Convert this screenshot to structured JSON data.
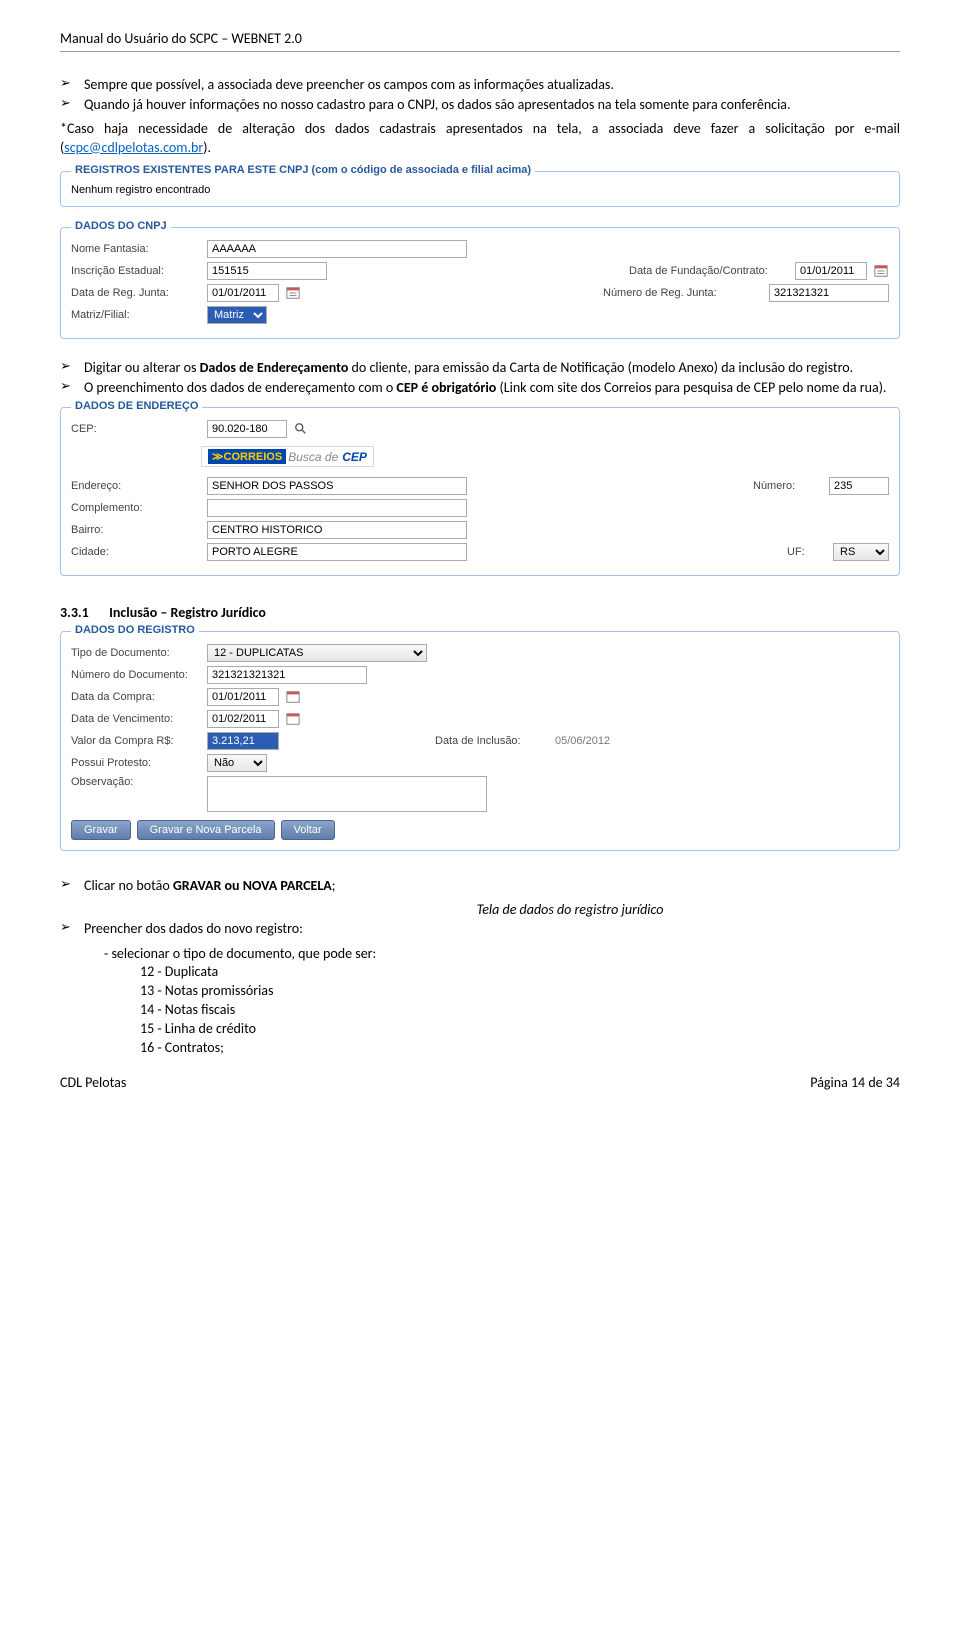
{
  "header": {
    "title": "Manual do Usuário do SCPC – WEBNET 2.0"
  },
  "intro": {
    "b1": "Sempre que possível, a associada deve preencher os campos com as informações atualizadas.",
    "b2": "Quando já houver informações no nosso cadastro para o CNPJ, os dados são apresentados na tela somente para conferência.",
    "note_pre": "*Caso haja necessidade de alteração dos dados cadastrais apresentados na tela, a associada deve fazer a solicitação por e-mail (",
    "note_link": "scpc@cdlpelotas.com.br",
    "note_post": ")."
  },
  "panel_reg": {
    "title": "REGISTROS EXISTENTES PARA ESTE CNPJ (com o código de associada e filial acima)",
    "body": "Nenhum registro encontrado"
  },
  "panel_cnpj": {
    "title": "DADOS DO CNPJ",
    "lbl_nome": "Nome Fantasia:",
    "val_nome": "AAAAAA",
    "lbl_insc": "Inscrição Estadual:",
    "val_insc": "151515",
    "lbl_fund": "Data  de Fundação/Contrato:",
    "val_fund": "01/01/2011",
    "lbl_regj": "Data de Reg. Junta:",
    "val_regj": "01/01/2011",
    "lbl_numj": "Número de Reg. Junta:",
    "val_numj": "321321321",
    "lbl_mf": "Matriz/Filial:",
    "val_mf": "Matriz"
  },
  "mid": {
    "b1_pre": "Digitar ou alterar os ",
    "b1_bold": "Dados de Endereçamento",
    "b1_post": " do cliente, para emissão da Carta de Notificação (modelo Anexo) da inclusão do registro.",
    "b2_pre": "O preenchimento dos dados de endereçamento com o ",
    "b2_bold": "CEP é obrigatório",
    "b2_post": " (Link com site dos Correios para pesquisa de CEP pelo nome da rua)."
  },
  "panel_end": {
    "title": "DADOS DE ENDEREÇO",
    "lbl_cep": "CEP:",
    "val_cep": "90.020-180",
    "correios_logo": "CORREIOS",
    "correios_busca": "Busca de",
    "correios_cep": "CEP",
    "lbl_end": "Endereço:",
    "val_end": "SENHOR DOS PASSOS",
    "lbl_num": "Número:",
    "val_num": "235",
    "lbl_comp": "Complemento:",
    "val_comp": "",
    "lbl_bairro": "Bairro:",
    "val_bairro": "CENTRO HISTORICO",
    "lbl_cid": "Cidade:",
    "val_cid": "PORTO ALEGRE",
    "lbl_uf": "UF:",
    "val_uf": "RS"
  },
  "section": {
    "num": "3.3.1",
    "title": "Inclusão – Registro Jurídico"
  },
  "panel_regdata": {
    "title": "DADOS DO REGISTRO",
    "lbl_tipo": "Tipo de Documento:",
    "val_tipo": "12 - DUPLICATAS",
    "lbl_numdoc": "Número do Documento:",
    "val_numdoc": "321321321321",
    "lbl_compra": "Data da Compra:",
    "val_compra": "01/01/2011",
    "lbl_venc": "Data de Vencimento:",
    "val_venc": "01/02/2011",
    "lbl_valor": "Valor da Compra R$:",
    "val_valor": "3.213,21",
    "lbl_incl": "Data de Inclusão:",
    "val_incl": "05/06/2012",
    "lbl_prot": "Possui Protesto:",
    "val_prot": "Não",
    "lbl_obs": "Observação:",
    "val_obs": "",
    "btn_gravar": "Gravar",
    "btn_nova": "Gravar e Nova Parcela",
    "btn_voltar": "Voltar"
  },
  "end": {
    "b1_pre": "Clicar no botão ",
    "b1_bold": "GRAVAR ou NOVA PARCELA",
    "b1_post": ";",
    "caption": "Tela de dados do registro jurídico",
    "b2": "Preencher dos dados do novo registro:",
    "sub1": "- selecionar o tipo de documento, que pode ser:",
    "o1": "12 - Duplicata",
    "o2": "13 - Notas promissórias",
    "o3": "14 - Notas fiscais",
    "o4": "15 - Linha de crédito",
    "o5": "16 - Contratos;"
  },
  "footer": {
    "left": "CDL Pelotas",
    "right": "Página 14 de 34"
  }
}
